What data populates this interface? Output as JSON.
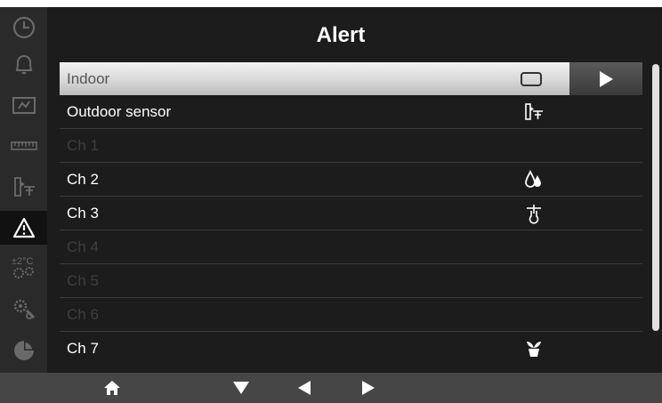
{
  "header": {
    "title": "Alert"
  },
  "sidebar": {
    "items": [
      {
        "icon": "clock-icon",
        "active": false
      },
      {
        "icon": "bell-icon",
        "active": false
      },
      {
        "icon": "display-icon",
        "active": false
      },
      {
        "icon": "ruler-icon",
        "active": false
      },
      {
        "icon": "sensor-icon",
        "active": false
      },
      {
        "icon": "alert-triangle-icon",
        "active": true
      },
      {
        "icon": "temperature-offset-icon",
        "active": false
      },
      {
        "icon": "settings-gears-icon",
        "active": false
      },
      {
        "icon": "pie-chart-icon",
        "active": false
      }
    ],
    "offset_label": "±2°C"
  },
  "list": {
    "rows": [
      {
        "label": "Indoor",
        "icon": "screen-icon",
        "state": "selected"
      },
      {
        "label": "Outdoor sensor",
        "icon": "sensor-icon",
        "state": "normal"
      },
      {
        "label": "Ch 1",
        "icon": "",
        "state": "disabled"
      },
      {
        "label": "Ch 2",
        "icon": "water-drops-icon",
        "state": "normal"
      },
      {
        "label": "Ch 3",
        "icon": "probe-icon",
        "state": "normal"
      },
      {
        "label": "Ch 4",
        "icon": "",
        "state": "disabled"
      },
      {
        "label": "Ch 5",
        "icon": "",
        "state": "disabled"
      },
      {
        "label": "Ch 6",
        "icon": "",
        "state": "disabled"
      },
      {
        "label": "Ch 7",
        "icon": "plant-pot-icon",
        "state": "normal"
      }
    ]
  },
  "bottom": {
    "buttons": [
      "home-icon",
      "arrow-down-icon",
      "arrow-left-icon",
      "arrow-right-icon"
    ]
  },
  "colors": {
    "background": "#1c1c1c",
    "sidebar": "#2a2a2a",
    "text": "#ffffff",
    "disabled_text": "#3e3e3e",
    "bottom_bar": "#464646"
  }
}
